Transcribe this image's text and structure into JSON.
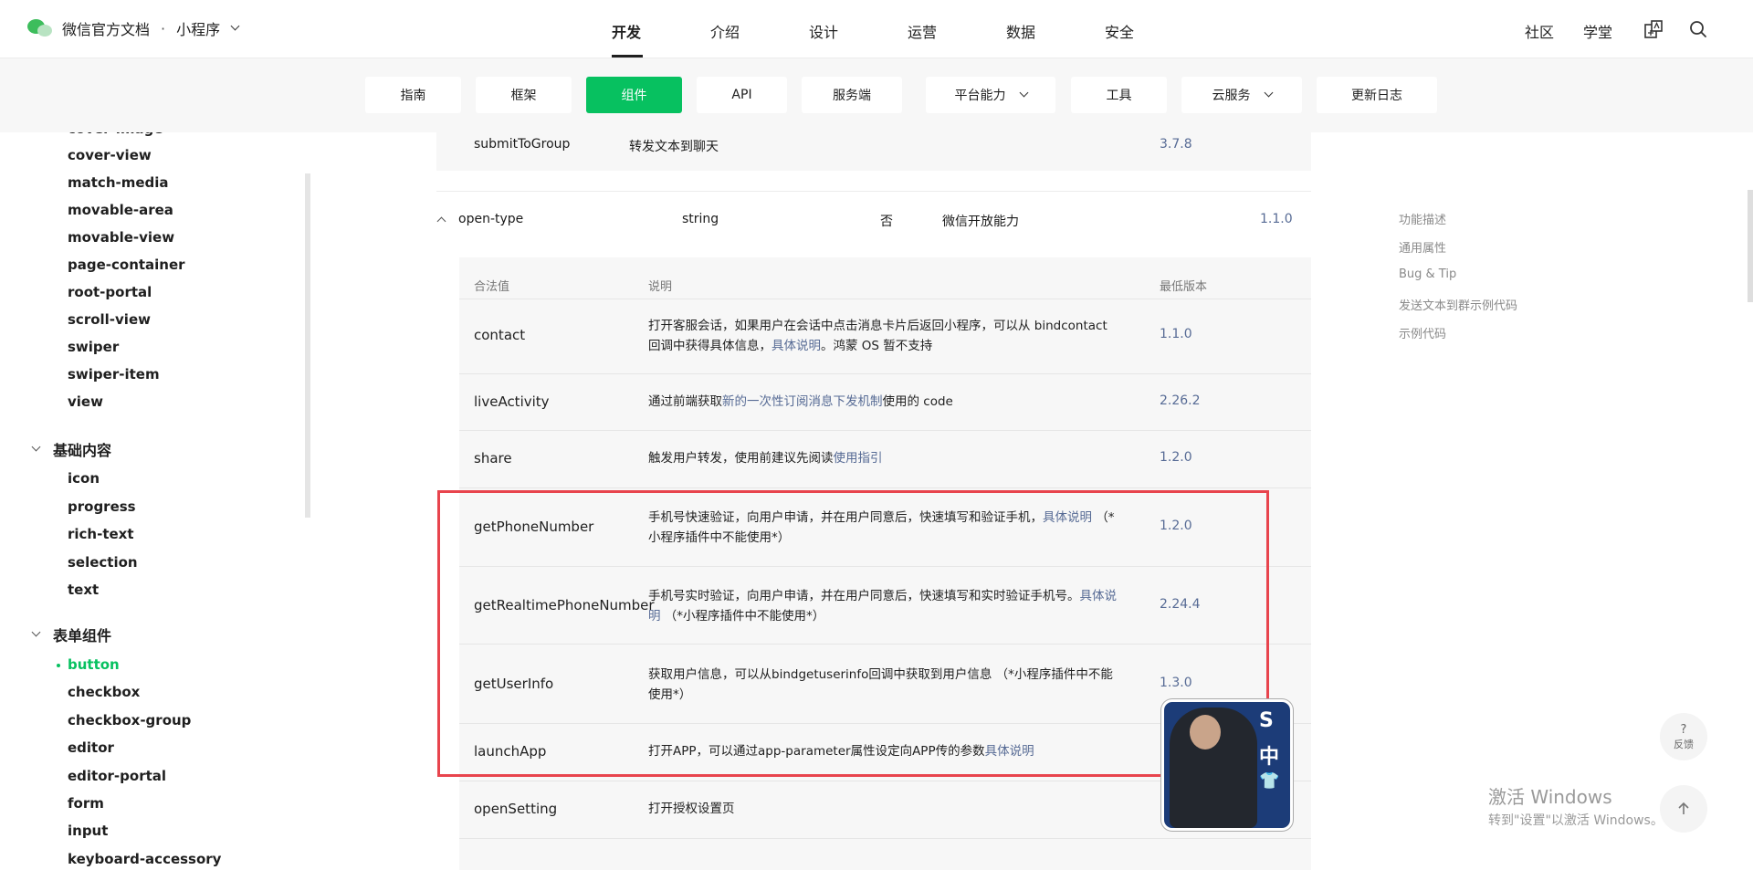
{
  "header": {
    "brand": "微信官方文档",
    "separator": "·",
    "product": "小程序",
    "nav": [
      "开发",
      "介绍",
      "设计",
      "运营",
      "数据",
      "安全"
    ],
    "right": [
      "社区",
      "学堂"
    ]
  },
  "subtabs": [
    "指南",
    "框架",
    "组件",
    "API",
    "服务端",
    "平台能力",
    "工具",
    "云服务",
    "更新日志"
  ],
  "sidebar": {
    "items_top": [
      "cover-image",
      "cover-view",
      "match-media",
      "movable-area",
      "movable-view",
      "page-container",
      "root-portal",
      "scroll-view",
      "swiper",
      "swiper-item",
      "view"
    ],
    "group_basic": "基础内容",
    "items_basic": [
      "icon",
      "progress",
      "rich-text",
      "selection",
      "text"
    ],
    "group_form": "表单组件",
    "items_form": [
      "button",
      "checkbox",
      "checkbox-group",
      "editor",
      "editor-portal",
      "form",
      "input",
      "keyboard-accessory"
    ]
  },
  "prev_row": {
    "name": "submitToGroup",
    "desc": "转发文本到聊天",
    "version": "3.7.8"
  },
  "attr": {
    "name": "open-type",
    "type": "string",
    "required": "否",
    "desc": "微信开放能力",
    "version": "1.1.0"
  },
  "subtable": {
    "headers": [
      "合法值",
      "说明",
      "最低版本"
    ],
    "rows": [
      {
        "name": "contact",
        "desc_pre": "打开客服会话，如果用户在会话中点击消息卡片后返回小程序，可以从 bindcontact 回调中获得具体信息，",
        "link": "具体说明",
        "desc_post": "。鸿蒙 OS 暂不支持",
        "version": "1.1.0"
      },
      {
        "name": "liveActivity",
        "desc_pre": "通过前端获取",
        "link": "新的一次性订阅消息下发机制",
        "desc_post": "使用的 code",
        "version": "2.26.2"
      },
      {
        "name": "share",
        "desc_pre": "触发用户转发，使用前建议先阅读",
        "link": "使用指引",
        "desc_post": "",
        "version": "1.2.0"
      },
      {
        "name": "getPhoneNumber",
        "desc_pre": "手机号快速验证，向用户申请，并在用户同意后，快速填写和验证手机，",
        "link": "具体说明",
        "desc_post": " （*小程序插件中不能使用*）",
        "version": "1.2.0"
      },
      {
        "name": "getRealtimePhoneNumber",
        "desc_pre": "手机号实时验证，向用户申请，并在用户同意后，快速填写和实时验证手机号。",
        "link": "具体说明",
        "desc_post": " （*小程序插件中不能使用*）",
        "version": "2.24.4"
      },
      {
        "name": "getUserInfo",
        "desc_pre": "获取用户信息，可以从bindgetuserinfo回调中获取到用户信息 （*小程序插件中不能使用*）",
        "link": "",
        "desc_post": "",
        "version": "1.3.0"
      },
      {
        "name": "launchApp",
        "desc_pre": "打开APP，可以通过app-parameter属性设定向APP传的参数",
        "link": "具体说明",
        "desc_post": "",
        "version": ""
      },
      {
        "name": "openSetting",
        "desc_pre": "打开授权设置页",
        "link": "",
        "desc_post": "",
        "version": ""
      }
    ]
  },
  "outline": [
    "功能描述",
    "通用属性",
    "Bug & Tip",
    "发送文本到群示例代码",
    "示例代码"
  ],
  "avatar_tags": [
    "S",
    "中",
    "👕"
  ],
  "float": {
    "help_icon": "?",
    "feedback": "反馈"
  },
  "activation": {
    "line1": "激活 Windows",
    "line2": "转到\"设置\"以激活 Windows。"
  },
  "colors": {
    "accent": "#07c160",
    "link": "#576b95",
    "highlight": "#e8444d"
  },
  "icons": [
    "wechat-logo-icon",
    "chevron-down-icon",
    "translate-icon",
    "search-icon",
    "chevron-up-icon",
    "arrow-up-icon"
  ]
}
